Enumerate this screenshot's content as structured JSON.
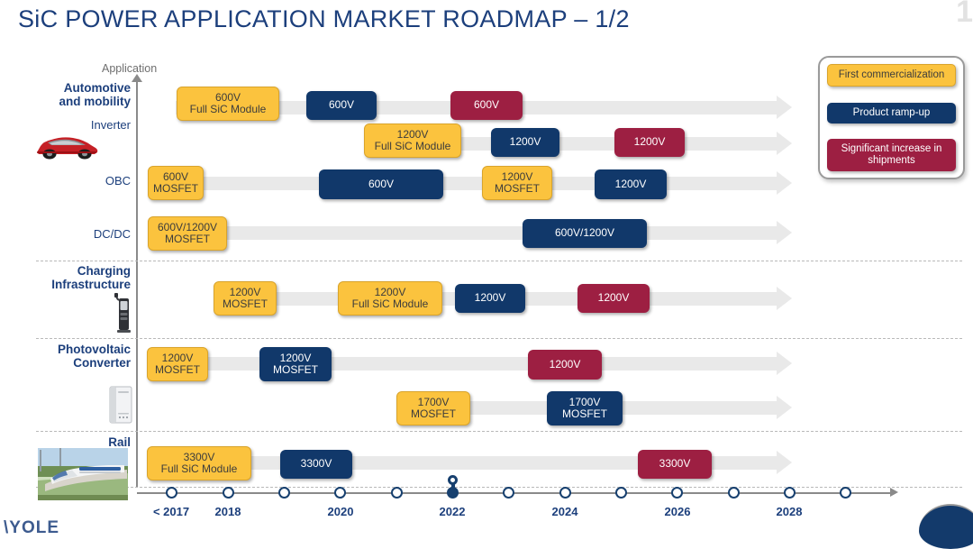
{
  "title": "SiC POWER APPLICATION MARKET ROADMAP – 1/2",
  "axis_caption": "Application",
  "legend": {
    "items": [
      {
        "label": "First commercialization",
        "color": "#fbc33e",
        "kind": "yellow"
      },
      {
        "label": "Product ramp-up",
        "color": "#11386a",
        "kind": "navy"
      },
      {
        "label": "Significant increase in shipments",
        "color": "#9d1f42",
        "kind": "maroon"
      }
    ]
  },
  "colors": {
    "yellow": "#fbc33e",
    "navy": "#11386a",
    "maroon": "#9d1f42",
    "track": "#e9e9e9",
    "title": "#1c3f7c"
  },
  "groups": [
    {
      "name": "automotive",
      "label_line1": "Automotive",
      "label_line2": "and mobility",
      "icon": "car-icon"
    },
    {
      "name": "charging",
      "label_line1": "Charging",
      "label_line2": "Infrastructure",
      "icon": "ev-charger-icon"
    },
    {
      "name": "photovoltaic",
      "label_line1": "Photovoltaic",
      "label_line2": "Converter",
      "icon": "solar-inverter-icon"
    },
    {
      "name": "rail",
      "label_line1": "Rail",
      "label_line2": "",
      "icon": "train-icon"
    }
  ],
  "sub_labels": [
    {
      "name": "inverter",
      "label": "Inverter"
    },
    {
      "name": "obc",
      "label": "OBC"
    },
    {
      "name": "dcdc",
      "label": "DC/DC"
    }
  ],
  "rows": [
    {
      "name": "automotive-inverter-600v",
      "boxes": [
        {
          "kind": "yellow",
          "line1": "600V",
          "line2": "Full SiC Module"
        },
        {
          "kind": "navy",
          "line1": "600V",
          "line2": ""
        },
        {
          "kind": "maroon",
          "line1": "600V",
          "line2": ""
        }
      ]
    },
    {
      "name": "automotive-inverter-1200v",
      "boxes": [
        {
          "kind": "yellow",
          "line1": "1200V",
          "line2": "Full SiC Module"
        },
        {
          "kind": "navy",
          "line1": "1200V",
          "line2": ""
        },
        {
          "kind": "maroon",
          "line1": "1200V",
          "line2": ""
        }
      ]
    },
    {
      "name": "automotive-obc",
      "boxes": [
        {
          "kind": "yellow",
          "line1": "600V",
          "line2": "MOSFET"
        },
        {
          "kind": "navy",
          "line1": "600V",
          "line2": ""
        },
        {
          "kind": "yellow",
          "line1": "1200V",
          "line2": "MOSFET"
        },
        {
          "kind": "navy",
          "line1": "1200V",
          "line2": ""
        }
      ]
    },
    {
      "name": "automotive-dcdc",
      "boxes": [
        {
          "kind": "yellow",
          "line1": "600V/1200V",
          "line2": "MOSFET"
        },
        {
          "kind": "navy",
          "line1": "600V/1200V",
          "line2": ""
        }
      ]
    },
    {
      "name": "charging-infrastructure",
      "boxes": [
        {
          "kind": "yellow",
          "line1": "1200V",
          "line2": "MOSFET"
        },
        {
          "kind": "yellow",
          "line1": "1200V",
          "line2": "Full SiC Module"
        },
        {
          "kind": "navy",
          "line1": "1200V",
          "line2": ""
        },
        {
          "kind": "maroon",
          "line1": "1200V",
          "line2": ""
        }
      ]
    },
    {
      "name": "photovoltaic-1200v",
      "boxes": [
        {
          "kind": "yellow",
          "line1": "1200V",
          "line2": "MOSFET"
        },
        {
          "kind": "navy",
          "line1": "1200V",
          "line2": "MOSFET"
        },
        {
          "kind": "maroon",
          "line1": "1200V",
          "line2": ""
        }
      ]
    },
    {
      "name": "photovoltaic-1700v",
      "boxes": [
        {
          "kind": "yellow",
          "line1": "1700V",
          "line2": "MOSFET"
        },
        {
          "kind": "navy",
          "line1": "1700V",
          "line2": "MOSFET"
        }
      ]
    },
    {
      "name": "rail",
      "boxes": [
        {
          "kind": "yellow",
          "line1": "3300V",
          "line2": "Full SiC Module"
        },
        {
          "kind": "navy",
          "line1": "3300V",
          "line2": ""
        },
        {
          "kind": "maroon",
          "line1": "3300V",
          "line2": ""
        }
      ]
    }
  ],
  "timeline": {
    "labels": [
      "< 2017",
      "2018",
      "2020",
      "2022",
      "2024",
      "2026",
      "2028"
    ],
    "tick_count": 13,
    "current_index": 5,
    "current_year": "2022"
  },
  "footer": {
    "logo": "YOLE"
  }
}
